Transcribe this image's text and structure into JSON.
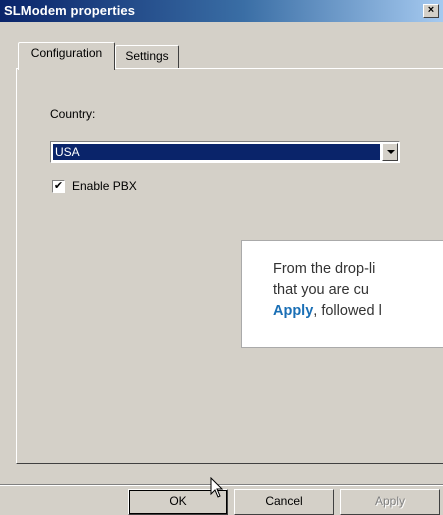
{
  "window": {
    "title": "SLModem properties",
    "close_glyph": "×"
  },
  "tabs": [
    {
      "label": "Configuration",
      "active": true
    },
    {
      "label": "Settings",
      "active": false
    }
  ],
  "country": {
    "label": "Country:",
    "selected": "USA"
  },
  "pbx": {
    "label": "Enable PBX",
    "checked": true,
    "check_glyph": "✔"
  },
  "tooltip": {
    "line1": "From the drop-li",
    "line2": "that you are cu",
    "line3_bold": "Apply",
    "line3_rest": ", followed l"
  },
  "buttons": {
    "ok": "OK",
    "cancel": "Cancel",
    "apply": "Apply"
  },
  "icons": {
    "cursor": "arrow-pointer"
  }
}
